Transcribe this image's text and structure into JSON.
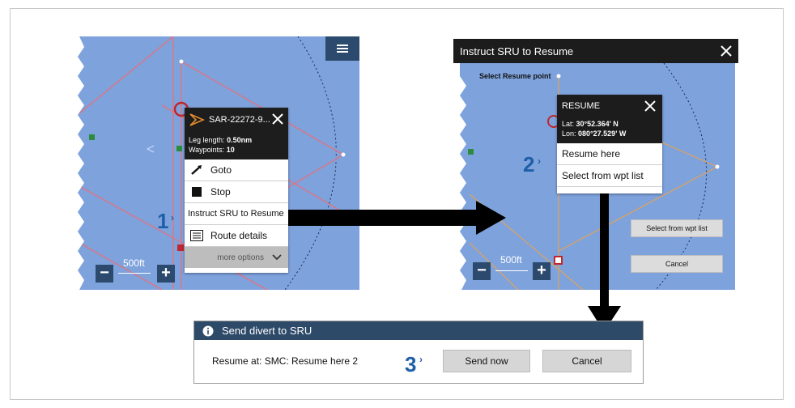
{
  "left_screen": {
    "context_menu": {
      "title": "SAR-22272-9...",
      "leg_length_label": "Leg length:",
      "leg_length_value": "0.50nm",
      "waypoints_label": "Waypoints:",
      "waypoints_value": "10",
      "items": [
        {
          "label": "Goto",
          "icon": "goto-icon"
        },
        {
          "label": "Stop",
          "icon": "stop-icon"
        },
        {
          "label": "Instruct SRU to Resume",
          "icon": ""
        },
        {
          "label": "Route details",
          "icon": "list-icon"
        }
      ],
      "more_options": "more options"
    },
    "scale": "500ft",
    "zoom_out": "−",
    "zoom_in": "+"
  },
  "right_screen": {
    "title": "Instruct SRU to Resume",
    "select_resume_point": "Select Resume point",
    "resume_popup": {
      "title": "RESUME",
      "lat_label": "Lat:",
      "lat_value": "30°52.364' N",
      "lon_label": "Lon:",
      "lon_value": "080°27.529' W",
      "items": [
        "Resume here",
        "Select from wpt list"
      ]
    },
    "select_from_wpt_list_button": "Select from wpt list",
    "cancel_button": "Cancel",
    "scale": "500ft",
    "zoom_out": "−",
    "zoom_in": "+"
  },
  "dialog": {
    "title": "Send divert to SRU",
    "message": "Resume at: SMC: Resume here 2",
    "send_button": "Send now",
    "cancel_button": "Cancel"
  },
  "steps": [
    "1",
    "2",
    "3"
  ],
  "colors": {
    "map_blue": "#7ea2dc",
    "route_pink": "#d27a8f",
    "route_orange": "#e0a25a",
    "header_dark": "#1c1c1c",
    "dialog_header": "#2e4a69",
    "step_blue": "#1f5fa8"
  }
}
